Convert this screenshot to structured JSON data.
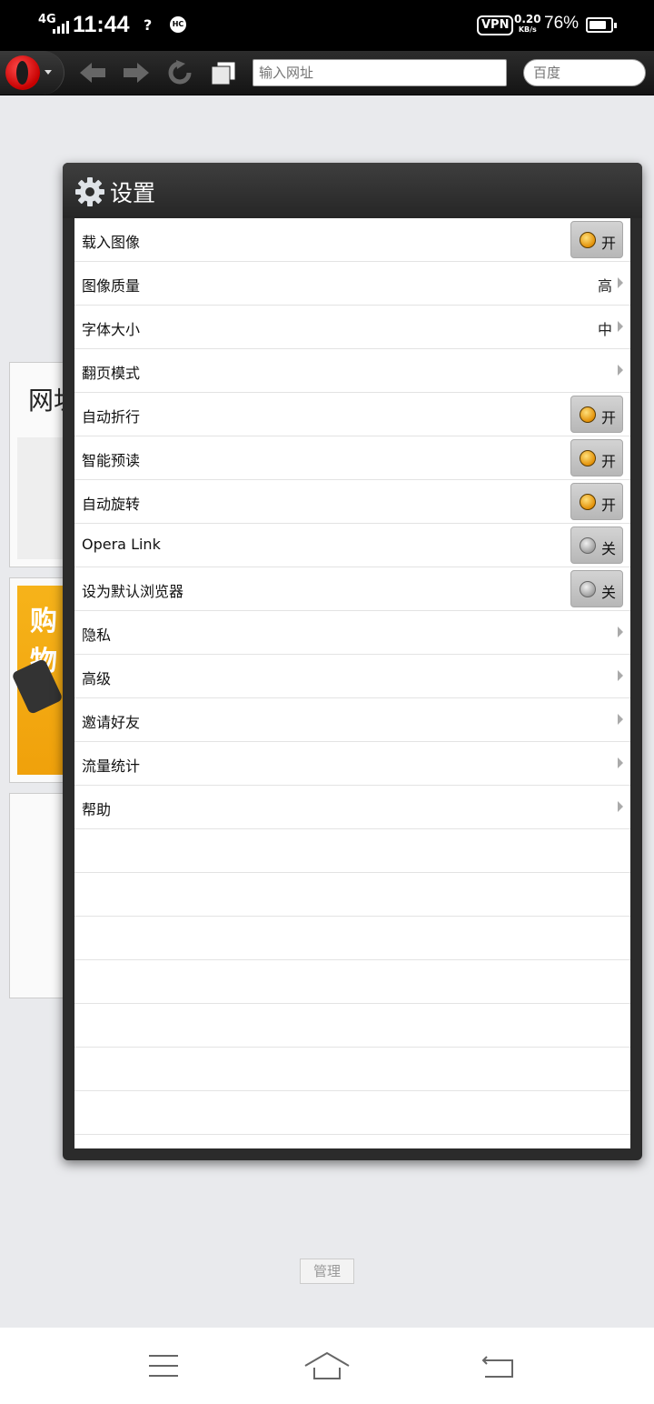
{
  "status_bar": {
    "network": "4G",
    "time": "11:44",
    "signal2": "?",
    "hc_badge": "HC",
    "vpn": "VPN",
    "speed_value": "0.20",
    "speed_unit": "KB/s",
    "battery": "76%",
    "battery_level": 0.76
  },
  "toolbar": {
    "url_placeholder": "输入网址",
    "search_placeholder": "百度"
  },
  "background": {
    "card1_title": "网址",
    "card2_ad_text": "购物",
    "manage_label": "管理"
  },
  "dialog": {
    "title": "设置",
    "rows": [
      {
        "label": "载入图像",
        "kind": "toggle",
        "state": "on",
        "text": "开"
      },
      {
        "label": "图像质量",
        "kind": "select",
        "value": "高"
      },
      {
        "label": "字体大小",
        "kind": "select",
        "value": "中"
      },
      {
        "label": "翻页模式",
        "kind": "nav"
      },
      {
        "label": "自动折行",
        "kind": "toggle",
        "state": "on",
        "text": "开"
      },
      {
        "label": "智能预读",
        "kind": "toggle",
        "state": "on",
        "text": "开"
      },
      {
        "label": "自动旋转",
        "kind": "toggle",
        "state": "on",
        "text": "开"
      },
      {
        "label": "Opera Link",
        "kind": "toggle",
        "state": "off",
        "text": "关"
      },
      {
        "label": "设为默认浏览器",
        "kind": "toggle",
        "state": "off",
        "text": "关"
      },
      {
        "label": "隐私",
        "kind": "nav"
      },
      {
        "label": "高级",
        "kind": "nav"
      },
      {
        "label": "邀请好友",
        "kind": "nav"
      },
      {
        "label": "流量统计",
        "kind": "nav"
      },
      {
        "label": "帮助",
        "kind": "nav"
      }
    ]
  },
  "colors": {
    "accent_on": "#e08b00",
    "dialog_bg": "#2b2b2b",
    "opera_red": "#c60000"
  }
}
